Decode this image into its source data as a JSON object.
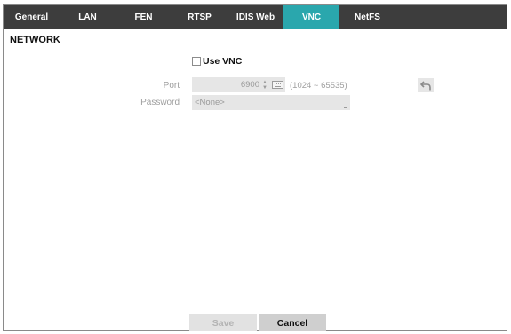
{
  "tabs": [
    {
      "label": "General",
      "active": false
    },
    {
      "label": "LAN",
      "active": false
    },
    {
      "label": "FEN",
      "active": false
    },
    {
      "label": "RTSP",
      "active": false
    },
    {
      "label": "IDIS Web",
      "active": false
    },
    {
      "label": "VNC",
      "active": true
    },
    {
      "label": "NetFS",
      "active": false
    }
  ],
  "section_title": "NETWORK",
  "use_vnc": {
    "label": "Use VNC",
    "checked": false
  },
  "port": {
    "label": "Port",
    "value": "6900",
    "range": "(1024 ~ 65535)"
  },
  "password": {
    "label": "Password",
    "value": "<None>"
  },
  "buttons": {
    "save": "Save",
    "cancel": "Cancel"
  },
  "colors": {
    "tabbar": "#3d3d3d",
    "active_tab": "#2aa7ad",
    "field_bg": "#e6e6e6"
  },
  "icons": {
    "revert": "undo-arrow-icon",
    "keyboard": "keyboard-icon",
    "spin": "spin-arrows-icon"
  }
}
